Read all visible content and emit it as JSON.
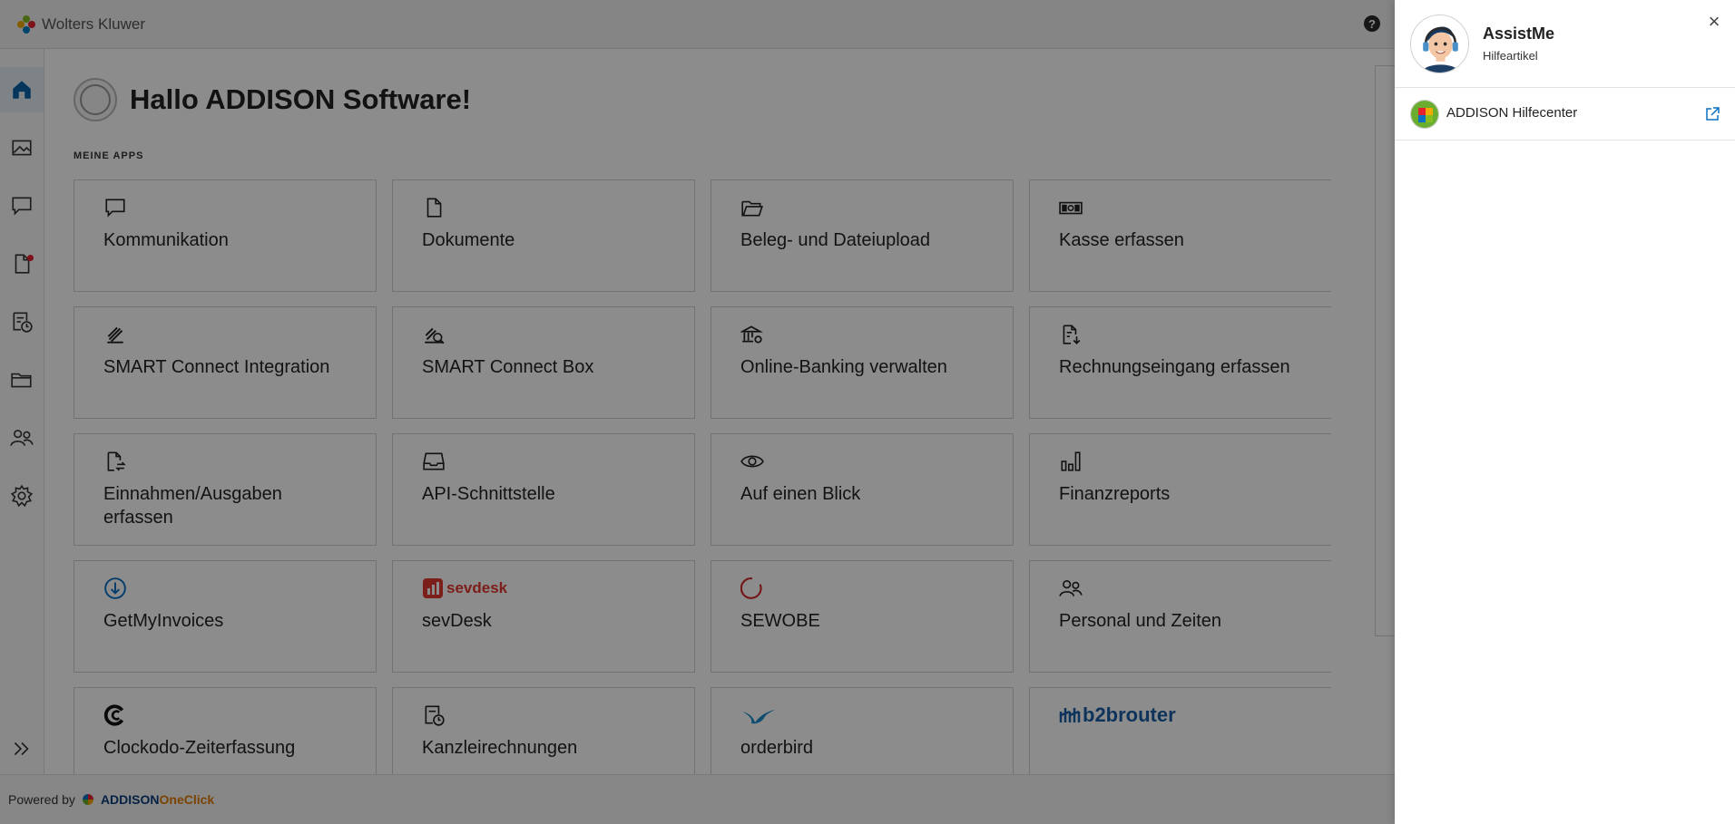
{
  "brand": {
    "name": "Wolters Kluwer"
  },
  "topbar": {
    "help_icon": "help-circle-icon",
    "help_glyph": "?"
  },
  "sidebar": {
    "items": [
      {
        "name": "home",
        "icon": "home-icon",
        "active": true
      },
      {
        "name": "image",
        "icon": "image-icon"
      },
      {
        "name": "messages",
        "icon": "chat-icon"
      },
      {
        "name": "documents",
        "icon": "document-icon",
        "notification": true
      },
      {
        "name": "invoices",
        "icon": "invoice-clock-icon"
      },
      {
        "name": "folders",
        "icon": "folder-icon"
      },
      {
        "name": "people",
        "icon": "people-icon"
      },
      {
        "name": "settings",
        "icon": "gear-icon"
      }
    ],
    "expand_icon": "double-chevron-right-icon"
  },
  "main": {
    "greeting": "Hallo ADDISON Software!",
    "section_label": "MEINE APPS",
    "tiles": [
      {
        "label": "Kommunikation",
        "icon": "chat-icon"
      },
      {
        "label": "Dokumente",
        "icon": "document-icon"
      },
      {
        "label": "Beleg- und Dateiupload",
        "icon": "folder-open-icon"
      },
      {
        "label": "Kasse erfassen",
        "icon": "cash-icon"
      },
      {
        "label": "SMART Connect Integration",
        "icon": "smart-connect-icon"
      },
      {
        "label": "SMART Connect Box",
        "icon": "smart-connect-box-icon"
      },
      {
        "label": "Online-Banking verwalten",
        "icon": "bank-gear-icon"
      },
      {
        "label": "Rechnungseingang erfassen",
        "icon": "invoice-in-icon"
      },
      {
        "label": "Einnahmen/Ausgaben erfassen",
        "icon": "document-exchange-icon"
      },
      {
        "label": "API-Schnittstelle",
        "icon": "inbox-icon"
      },
      {
        "label": "Auf einen Blick",
        "icon": "eye-icon"
      },
      {
        "label": "Finanzreports",
        "icon": "bar-chart-icon"
      },
      {
        "label": "GetMyInvoices",
        "icon": "download-circle-icon"
      },
      {
        "label": "sevDesk",
        "icon": "sevdesk-logo",
        "logo_text": "sevdesk"
      },
      {
        "label": "SEWOBE",
        "icon": "sewobe-circle-icon"
      },
      {
        "label": "Personal und Zeiten",
        "icon": "people-icon"
      },
      {
        "label": "Clockodo-Zeiterfassung",
        "icon": "clockodo-logo"
      },
      {
        "label": "Kanzleirechnungen",
        "icon": "invoice-clock-icon"
      },
      {
        "label": "orderbird",
        "icon": "orderbird-logo"
      },
      {
        "label": "",
        "icon": "b2brouter-logo",
        "logo_text": "b2brouter"
      }
    ]
  },
  "footer": {
    "powered_by": "Powered by",
    "addison": "ADDISON",
    "oneclick": "OneClick"
  },
  "assist_panel": {
    "title": "AssistMe",
    "subtitle": "Hilfeartikel",
    "close_glyph": "×",
    "links": [
      {
        "label": "ADDISON Hilfecenter",
        "icon": "external-link-icon"
      }
    ]
  },
  "colors": {
    "accent": "#0a70c4",
    "brand_blue": "#0a3d7a",
    "oneclick_orange": "#e07b00",
    "alert_red": "#e5202e"
  }
}
